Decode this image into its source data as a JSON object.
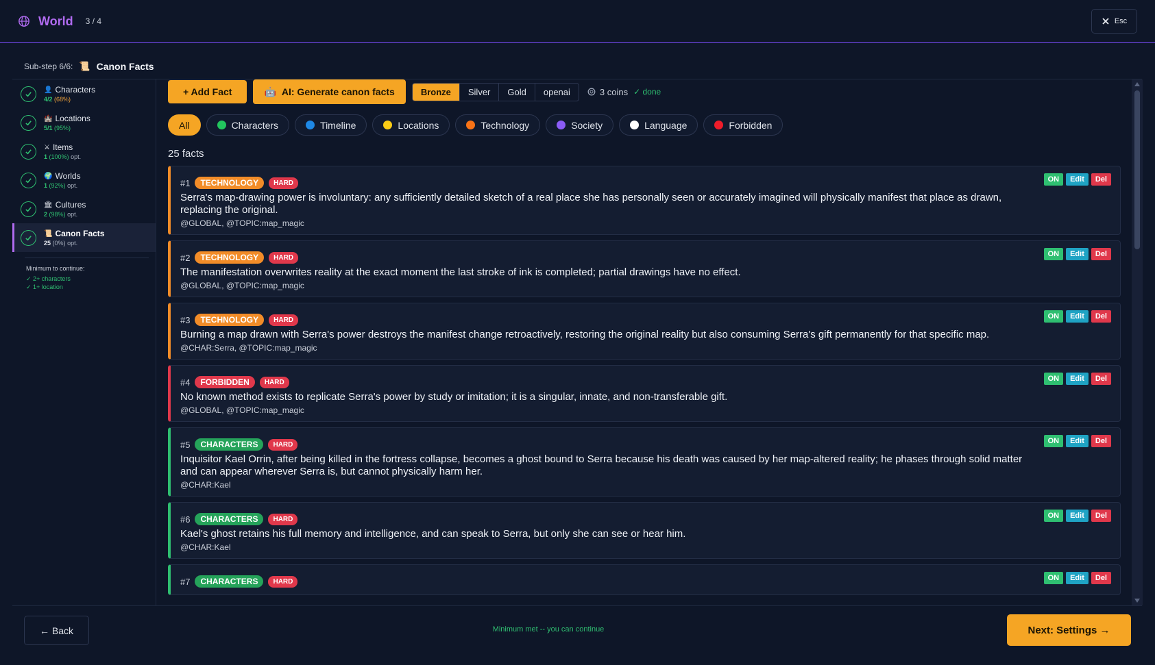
{
  "header": {
    "title": "World",
    "progress": "3 / 4",
    "esc_label": "Esc"
  },
  "substep": {
    "label": "Sub-step 6/6:",
    "icon": "scroll-icon",
    "title": "Canon Facts"
  },
  "sidebar": {
    "items": [
      {
        "label": "Characters",
        "icon": "person-icon",
        "count": "4/2",
        "pct": "(68%)",
        "suffix": ""
      },
      {
        "label": "Locations",
        "icon": "castle-icon",
        "count": "5/1",
        "pct": "(95%)",
        "suffix": ""
      },
      {
        "label": "Items",
        "icon": "swords-icon",
        "count": "1",
        "pct": "(100%)",
        "suffix": "opt."
      },
      {
        "label": "Worlds",
        "icon": "globe-icon",
        "count": "1",
        "pct": "(92%)",
        "suffix": "opt."
      },
      {
        "label": "Cultures",
        "icon": "temple-icon",
        "count": "2",
        "pct": "(98%)",
        "suffix": "opt."
      },
      {
        "label": "Canon Facts",
        "icon": "scroll-icon",
        "count": "25",
        "pct": "(0%)",
        "suffix": "opt."
      }
    ],
    "minimum_title": "Minimum to continue:",
    "requirements": [
      "✓ 2+ characters",
      "✓ 1+ location"
    ]
  },
  "toolbar": {
    "add_label": "+ Add Fact",
    "ai_label": "AI: Generate canon facts",
    "tiers": [
      "Bronze",
      "Silver",
      "Gold",
      "openai"
    ],
    "selected_tier": "Bronze",
    "coins": "3 coins",
    "status": "✓ done"
  },
  "filters": [
    {
      "label": "All",
      "color": ""
    },
    {
      "label": "Characters",
      "color": "#22c55e"
    },
    {
      "label": "Timeline",
      "color": "#1e88e5"
    },
    {
      "label": "Locations",
      "color": "#facc15"
    },
    {
      "label": "Technology",
      "color": "#f97316"
    },
    {
      "label": "Society",
      "color": "#8b5cf6"
    },
    {
      "label": "Language",
      "color": "#ffffff"
    },
    {
      "label": "Forbidden",
      "color": "#ef1c2a"
    }
  ],
  "fact_count": "25 facts",
  "facts": [
    {
      "num": "#1",
      "category": "TECHNOLOGY",
      "severity": "HARD",
      "text": "Serra's map-drawing power is involuntary: any sufficiently detailed sketch of a real place she has personally seen or accurately imagined will physically manifest that place as drawn, replacing the original.",
      "tags": "@GLOBAL, @TOPIC:map_magic"
    },
    {
      "num": "#2",
      "category": "TECHNOLOGY",
      "severity": "HARD",
      "text": "The manifestation overwrites reality at the exact moment the last stroke of ink is completed; partial drawings have no effect.",
      "tags": "@GLOBAL, @TOPIC:map_magic"
    },
    {
      "num": "#3",
      "category": "TECHNOLOGY",
      "severity": "HARD",
      "text": "Burning a map drawn with Serra's power destroys the manifest change retroactively, restoring the original reality but also consuming Serra's gift permanently for that specific map.",
      "tags": "@CHAR:Serra, @TOPIC:map_magic"
    },
    {
      "num": "#4",
      "category": "FORBIDDEN",
      "severity": "HARD",
      "text": "No known method exists to replicate Serra's power by study or imitation; it is a singular, innate, and non-transferable gift.",
      "tags": "@GLOBAL, @TOPIC:map_magic"
    },
    {
      "num": "#5",
      "category": "CHARACTERS",
      "severity": "HARD",
      "text": "Inquisitor Kael Orrin, after being killed in the fortress collapse, becomes a ghost bound to Serra because his death was caused by her map-altered reality; he phases through solid matter and can appear wherever Serra is, but cannot physically harm her.",
      "tags": "@CHAR:Kael"
    },
    {
      "num": "#6",
      "category": "CHARACTERS",
      "severity": "HARD",
      "text": "Kael's ghost retains his full memory and intelligence, and can speak to Serra, but only she can see or hear him.",
      "tags": "@CHAR:Kael"
    },
    {
      "num": "#7",
      "category": "CHARACTERS",
      "severity": "HARD",
      "text": "",
      "tags": ""
    }
  ],
  "fact_actions": {
    "on": "ON",
    "edit": "Edit",
    "del": "Del"
  },
  "footer": {
    "back_label": "← Back",
    "status": "Minimum met -- you can continue",
    "next_label": "Next: Settings →"
  }
}
